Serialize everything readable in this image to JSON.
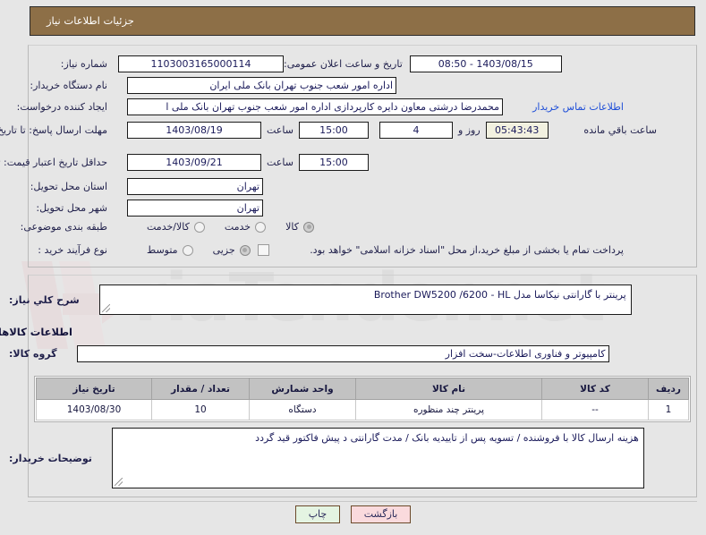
{
  "header": {
    "title": "جزئیات اطلاعات نیاز"
  },
  "form": {
    "need_number_label": "شماره نیاز:",
    "need_number_value": "1103003165000114",
    "announce_label": "تاریخ و ساعت اعلان عمومی:",
    "announce_value": "1403/08/15 - 08:50",
    "buyer_org_label": "نام دستگاه خریدار:",
    "buyer_org_value": "اداره امور شعب جنوب تهران بانک ملی ایران",
    "creator_label": "ایجاد کننده درخواست:",
    "creator_value": "محمدرضا درشتی معاون دایره کارپردازی اداره امور شعب جنوب تهران بانک ملی ا",
    "contact_link": "اطلاعات تماس خریدار",
    "deadline_label": "مهلت ارسال پاسخ: تا تاریخ:",
    "deadline_date": "1403/08/19",
    "deadline_time_label": "ساعت",
    "deadline_time": "15:00",
    "remaining_days": "4",
    "remaining_days_label": "روز و",
    "remaining_clock": "05:43:43",
    "remaining_suffix": "ساعت باقي مانده",
    "price_validity_label": "حداقل تاریخ اعتبار قیمت: تا تاریخ:",
    "price_validity_date": "1403/09/21",
    "price_validity_time_label": "ساعت",
    "price_validity_time": "15:00",
    "province_label": "استان محل تحویل:",
    "province_value": "تهران",
    "city_label": "شهر محل تحویل:",
    "city_value": "تهران",
    "category_label": "طبقه بندی موضوعی:",
    "category_options": [
      {
        "label": "کالا",
        "selected": true
      },
      {
        "label": "خدمت",
        "selected": false
      },
      {
        "label": "کالا/خدمت",
        "selected": false
      }
    ],
    "purchase_type_label": "نوع فرآیند خرید :",
    "purchase_type_options": [
      {
        "label": "جزیی",
        "selected": true
      },
      {
        "label": "متوسط",
        "selected": false
      }
    ],
    "treasury_checkbox_label": "پرداخت تمام یا بخشی از مبلغ خرید،از محل \"اسناد خزانه اسلامی\" خواهد بود.",
    "treasury_checked": false
  },
  "details": {
    "summary_label": "شرح کلي نیاز:",
    "summary_value": "پرینتر با گارانتی نیکاسا    مدل   Brother   DW5200 /6200 - HL",
    "goods_section_title": "اطلاعات کالاهاي مورد نیاز",
    "group_label": "گروه کالا:",
    "group_value": "کامپیوتر و فناوری اطلاعات-سخت افزار",
    "notes_label": "توضیحات خریدار:",
    "notes_value": "هزینه ارسال کالا با فروشنده / تسویه پس از تاییدیه بانک / مدت گارانتی د پیش فاکتور قید گردد"
  },
  "table": {
    "columns": [
      "ردیف",
      "کد کالا",
      "نام کالا",
      "واحد شمارش",
      "تعداد / مقدار",
      "تاریخ نیاز"
    ],
    "rows": [
      [
        "1",
        "--",
        "پرینتر چند منظوره",
        "دستگاه",
        "10",
        "1403/08/30"
      ]
    ]
  },
  "footer": {
    "back_label": "بازگشت",
    "print_label": "چاپ"
  },
  "watermark": {
    "text": "riaTender.net"
  },
  "colors": {
    "header_bg": "#8d6f47",
    "page_bg": "#e6e6e6",
    "link": "#1f4fd8",
    "table_header_bg": "#c2c2c2",
    "back_button_bg": "#fadadd",
    "print_button_bg": "#e4f4e2"
  }
}
